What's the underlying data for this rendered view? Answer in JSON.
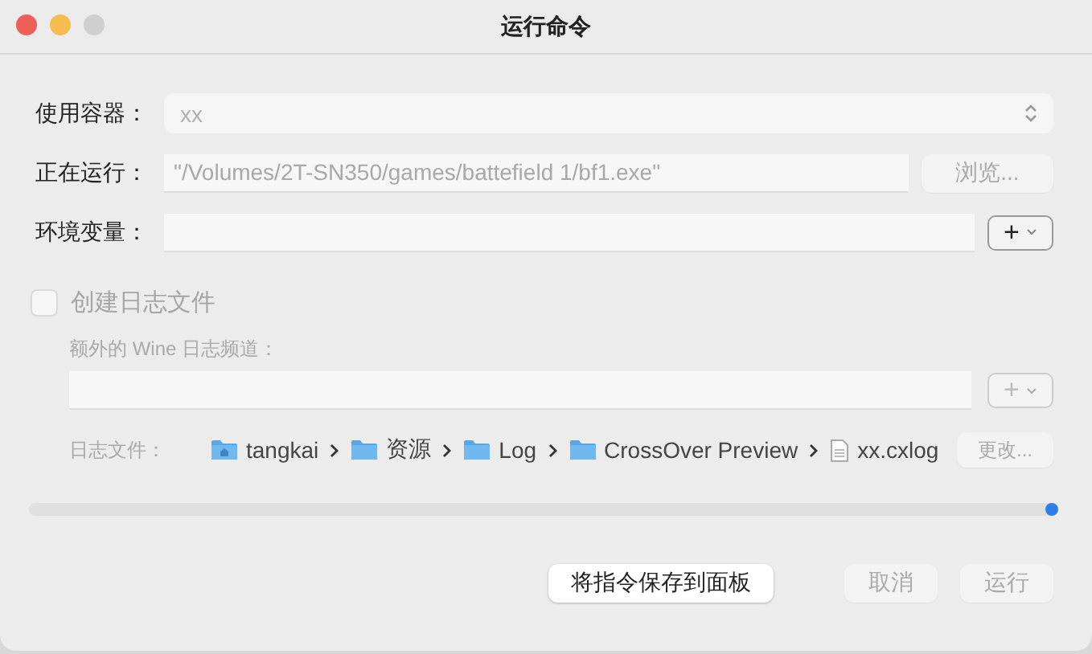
{
  "window": {
    "title": "运行命令"
  },
  "container": {
    "label": "使用容器：",
    "value": "xx",
    "disabled": true
  },
  "running": {
    "label": "正在运行：",
    "value": "\"/Volumes/2T-SN350/games/battefield 1/bf1.exe\"",
    "disabled": true,
    "browse": {
      "label": "浏览...",
      "disabled": true
    }
  },
  "env": {
    "label": "环境变量：",
    "add": {
      "label": "+",
      "disabled": false
    }
  },
  "log": {
    "checkbox": {
      "label": "创建日志文件",
      "checked": false,
      "disabled": true
    },
    "channels": {
      "label": "额外的 Wine 日志频道：",
      "add": {
        "label": "+",
        "disabled": true
      }
    },
    "file": {
      "label": "日志文件：",
      "path": [
        {
          "kind": "home",
          "name": "tangkai"
        },
        {
          "kind": "folder",
          "name": "资源"
        },
        {
          "kind": "folder",
          "name": "Log"
        },
        {
          "kind": "folder",
          "name": "CrossOver Preview"
        },
        {
          "kind": "file",
          "name": "xx.cxlog"
        }
      ],
      "change": {
        "label": "更改...",
        "disabled": true
      }
    }
  },
  "progress": {
    "level": 1
  },
  "buttons": [
    {
      "label": "将指令保存到面板",
      "disabled": false
    },
    {
      "label": "取消",
      "disabled": true
    },
    {
      "label": "运行",
      "disabled": true
    }
  ]
}
